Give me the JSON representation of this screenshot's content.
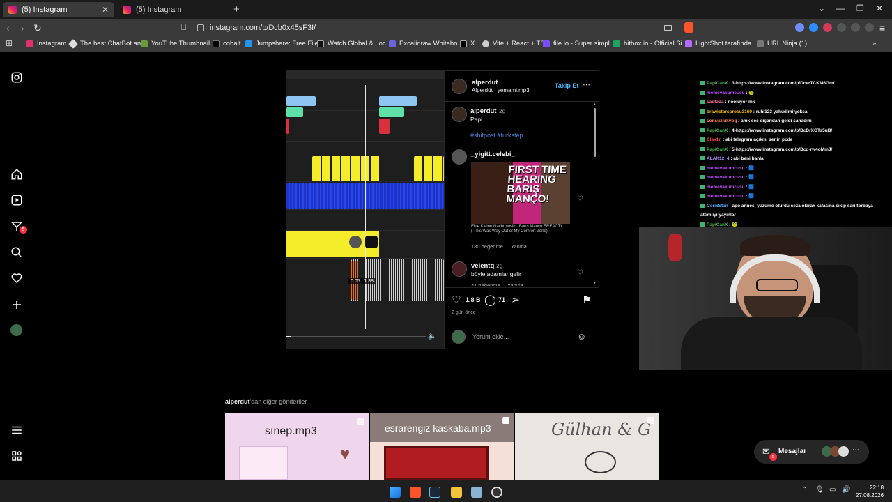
{
  "browser": {
    "tabs": [
      {
        "title": "(5) Instagram",
        "active": true
      },
      {
        "title": "(5) Instagram",
        "active": false
      }
    ],
    "url": "instagram.com/p/Dcb0x45sF3I/",
    "bookmarks": [
      "Instagram",
      "The best ChatBot an...",
      "YouTube Thumbnail...",
      "cobalt",
      "Jumpshare: Free File...",
      "Watch Global & Loc...",
      "Excalidraw Whitebo...",
      "X",
      "Vite + React + TS",
      "file.io - Super simpl...",
      "hitbox.io - Official Si...",
      "LightShot tarafında...",
      "URL Ninja (1)"
    ]
  },
  "sidebar": {
    "items": [
      "instagram-logo",
      "home",
      "reels",
      "messages",
      "search",
      "notifications",
      "create",
      "profile",
      "more",
      "meta-threads"
    ],
    "messages_badge": "5"
  },
  "post": {
    "video_time": "0:05 | 1:38",
    "author": "alperdut",
    "audio": "Alperdüt · yemami.mp3",
    "follow_label": "Takip Et",
    "caption": {
      "user": "alperdut",
      "time": "2g",
      "text": "Papi",
      "tags": "#shitpost #turkstep"
    },
    "comments": [
      {
        "user": "_yigitt.celebi_",
        "thumb_text": "FIRST TIME HEARING BARIŞ MANÇO!",
        "song_line": "Eine Kleine Nachtmusik · Barış Manço EREACTI",
        "song_line2": "( This Was Way Out of My Comfort Zone)",
        "likes": "180 beğenme",
        "reply": "Yanıtla"
      },
      {
        "user": "velentq",
        "time": "2g",
        "text": "böyle adamlar gelir",
        "likes": "41 beğenme",
        "reply": "Yanıtla"
      }
    ],
    "like_count": "1,8 B",
    "comment_count": "71",
    "posted": "2 gün önce",
    "comment_placeholder": "Yorum ekle..."
  },
  "more_posts": {
    "title_user": "alperdut",
    "title_rest": "'dan diğer gönderiler",
    "items": [
      "sınep.mp3",
      "esrarengiz kaskaba.mp3",
      "Gülhan & G"
    ]
  },
  "chat": [
    {
      "user": "PapiCanX",
      "color": "#4caf50",
      "msg": ": 3-https://www.instagram.com/p/DcerTCKM6Gm/"
    },
    {
      "user": "memevakumcusu",
      "color": "#c04cff",
      "msg": ": 🐸"
    },
    {
      "user": "sadfada",
      "color": "#ff6b9d",
      "msg": ": nooluyor mk"
    },
    {
      "user": "brawlstarsprosu3169",
      "color": "#f0c000",
      "msg": ": ruhi123 yahudimi yoksa"
    },
    {
      "user": "sonsuzlukvbg",
      "color": "#ff8a65",
      "msg": ": amk ses dışarıdan geldi sanadım"
    },
    {
      "user": "PapiCanX",
      "color": "#4caf50",
      "msg": ": 4-https://www.instagram.com/p/DcDrXGTs5uB/"
    },
    {
      "user": "Clax1n",
      "color": "#ff4d4d",
      "msg": ": abi telegram açıkmı senin pcde"
    },
    {
      "user": "PapiCanX",
      "color": "#4caf50",
      "msg": ": 5-https://www.instagram.com/p/Dcd-rw4oMmJ/"
    },
    {
      "user": "ALAN12_4",
      "color": "#b08cff",
      "msg": ": abi beni banla"
    },
    {
      "user": "memevakumcusu",
      "color": "#c04cff",
      "msg": ": 🟦"
    },
    {
      "user": "memevakumcusu",
      "color": "#c04cff",
      "msg": ": 🟦"
    },
    {
      "user": "memevakumcusu",
      "color": "#c04cff",
      "msg": ": 🟦"
    },
    {
      "user": "memevakumcusu",
      "color": "#c04cff",
      "msg": ": 🟦"
    },
    {
      "user": "CorixStan",
      "color": "#5fa8ff",
      "msg": ": apo annesi yüzüme oturdu ceza olarak kafasına sıkıp sarı torbaya"
    },
    {
      "user": "",
      "color": "#fff",
      "msg": "attım iyi yayınlar"
    },
    {
      "user": "PapiCanX",
      "color": "#4caf50",
      "msg": ": 🐸"
    }
  ],
  "messages_pill": {
    "label": "Mesajlar",
    "badge": "5"
  },
  "taskbar": {
    "time": "22:18",
    "date": "27.08.2026"
  }
}
